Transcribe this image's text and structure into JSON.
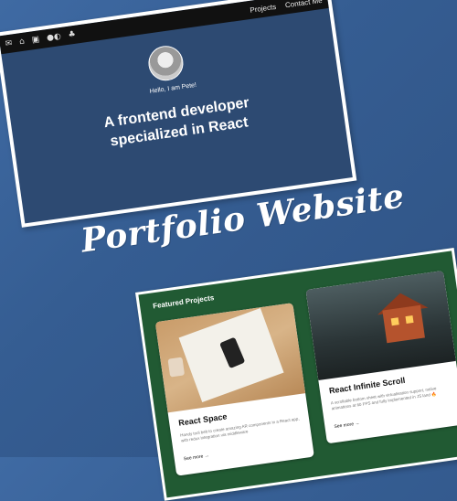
{
  "hero": {
    "nav_icons": [
      "✉",
      "",
      "▣",
      "●◐",
      "♣"
    ],
    "nav_icon_names": [
      "mail-icon",
      "github-icon",
      "linkedin-icon",
      "medium-icon",
      "other-icon"
    ],
    "nav_links": [
      "Projects",
      "Contact Me"
    ],
    "hello": "Hello, I am Pete!",
    "tagline_line1": "A frontend developer",
    "tagline_line2": "specialized in React"
  },
  "title": "Portfolio Website",
  "projects": {
    "heading": "Featured Projects",
    "items": [
      {
        "title": "React Space",
        "description": "Handy tool belt to create amazing AR components in a React app, with redux integration via middleware",
        "link": "See more →"
      },
      {
        "title": "React Infinite Scroll",
        "description": "A scrollable bottom sheet with virtualisation support, native animations at 60 FPS and fully implemented in JS land 🔥",
        "link": "See more →"
      }
    ]
  },
  "colors": {
    "background": "#3f6aa3",
    "hero_bg": "#2d4a72",
    "projects_bg": "#215a33"
  }
}
